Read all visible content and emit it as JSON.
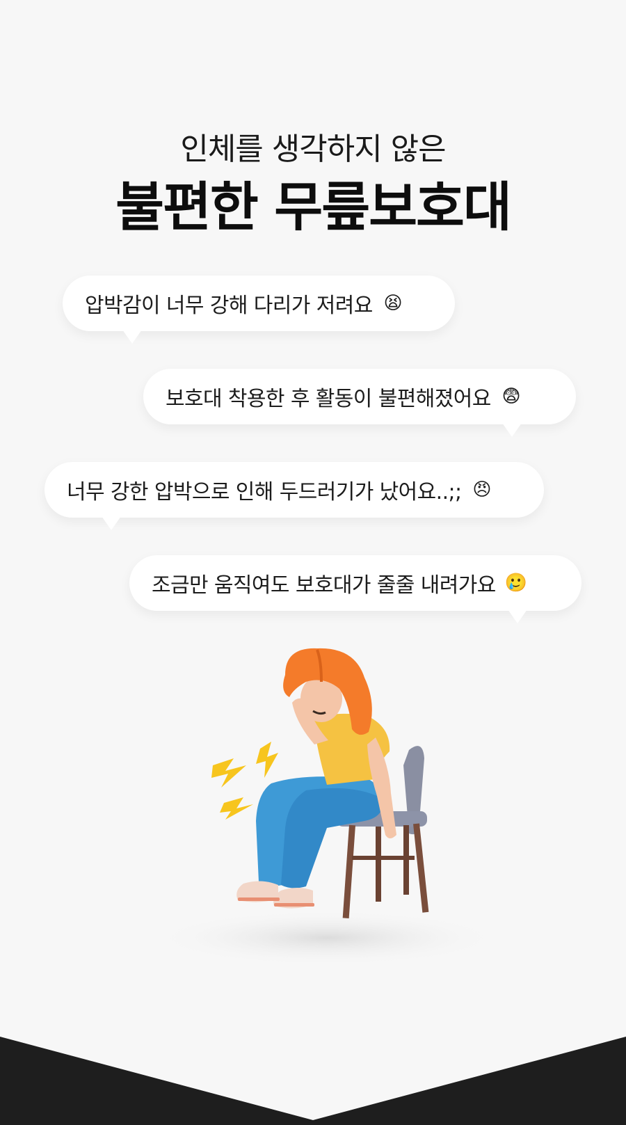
{
  "header": {
    "subtitle": "인체를 생각하지 않은",
    "title": "불편한 무릎보호대"
  },
  "bubbles": [
    {
      "text": "압박감이 너무 강해 다리가 저려요",
      "emoji": "😫",
      "icon": "tired-face-emoji"
    },
    {
      "text": "보호대 착용한 후 활동이 불편해졌어요",
      "emoji": "😨",
      "icon": "fearful-face-emoji"
    },
    {
      "text": "너무 강한 압박으로 인해 두드러기가 났어요..;;",
      "emoji": "😠",
      "icon": "angry-face-emoji"
    },
    {
      "text": "조금만 움직여도 보호대가 줄줄 내려가요",
      "emoji": "🥲",
      "icon": "smiling-face-with-tear-emoji"
    }
  ],
  "colors": {
    "background": "#f7f7f7",
    "bubble": "#ffffff",
    "hair": "#f47b2a",
    "shirt": "#f5c242",
    "pants": "#3e9ad6",
    "bolt": "#f7c51e",
    "bottom_band": "#1e1e1e"
  }
}
